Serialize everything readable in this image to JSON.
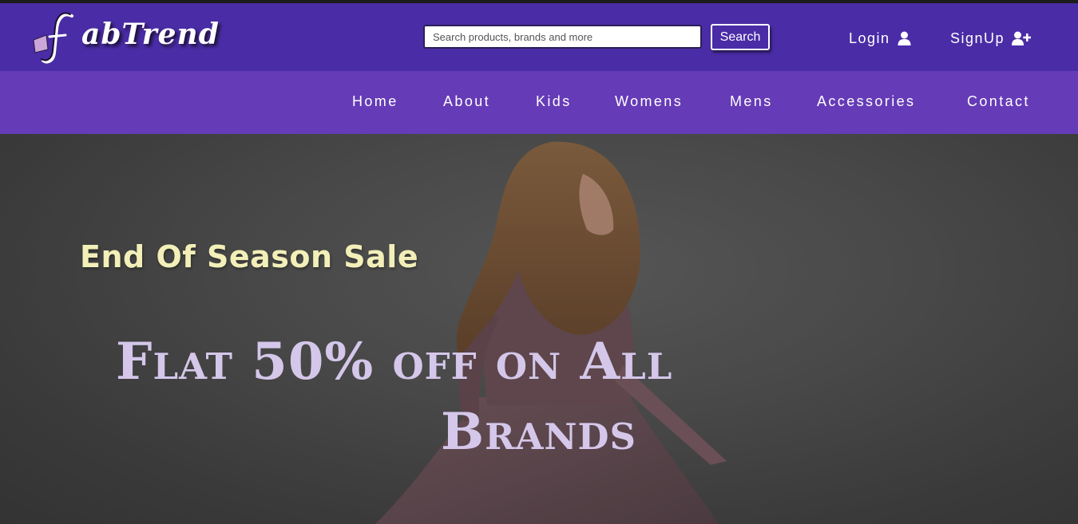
{
  "brand": {
    "name": "abTrend",
    "logo_letter": "f"
  },
  "search": {
    "placeholder": "Search products, brands and more",
    "button_label": "Search"
  },
  "auth": {
    "login_label": "Login",
    "login_icon": "user-icon",
    "signup_label": "SignUp",
    "signup_icon": "user-plus-icon"
  },
  "nav": {
    "items": [
      "Home",
      "About",
      "Kids",
      "Womens",
      "Mens",
      "Accessories",
      "Contact"
    ]
  },
  "hero": {
    "sale_title": "End Of Season Sale",
    "offer_line_1": "Flat 50% off on All",
    "offer_line_2": "Brands"
  },
  "colors": {
    "header_bg": "#4a2ca6",
    "navbar_bg": "#653bb7",
    "sale_title": "#f2efb8",
    "offer_text": "#d4c7ea"
  }
}
